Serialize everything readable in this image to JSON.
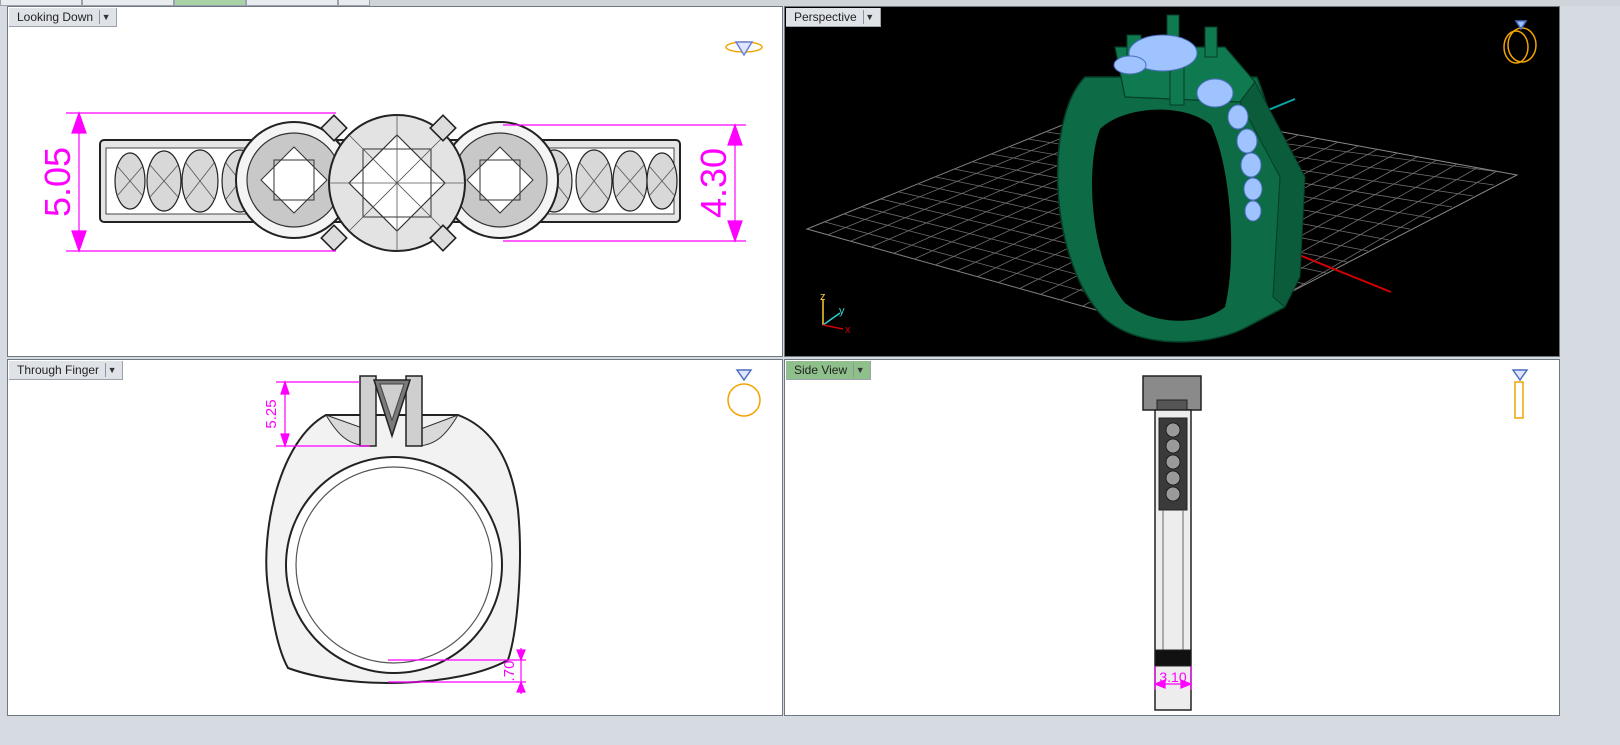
{
  "viewports": {
    "top": {
      "title": "Looking Down",
      "dims": {
        "left": "5.05",
        "right": "4.30"
      }
    },
    "perspective": {
      "title": "Perspective",
      "axes": {
        "z": "z",
        "y": "y",
        "x": "x"
      }
    },
    "front": {
      "title": "Through Finger",
      "dims": {
        "top": "5.25",
        "bottom": ".70"
      }
    },
    "side": {
      "title": "Side View",
      "dims": {
        "bottom": "3.10"
      }
    }
  },
  "colors": {
    "accent_dim": "#ff00ff",
    "metal_green": "#0d6b45",
    "gem_blue": "#9ec3ff",
    "active_title": "#8fbf8a",
    "grid": "#7f7f7f",
    "orient_icon": "#f2a400"
  }
}
